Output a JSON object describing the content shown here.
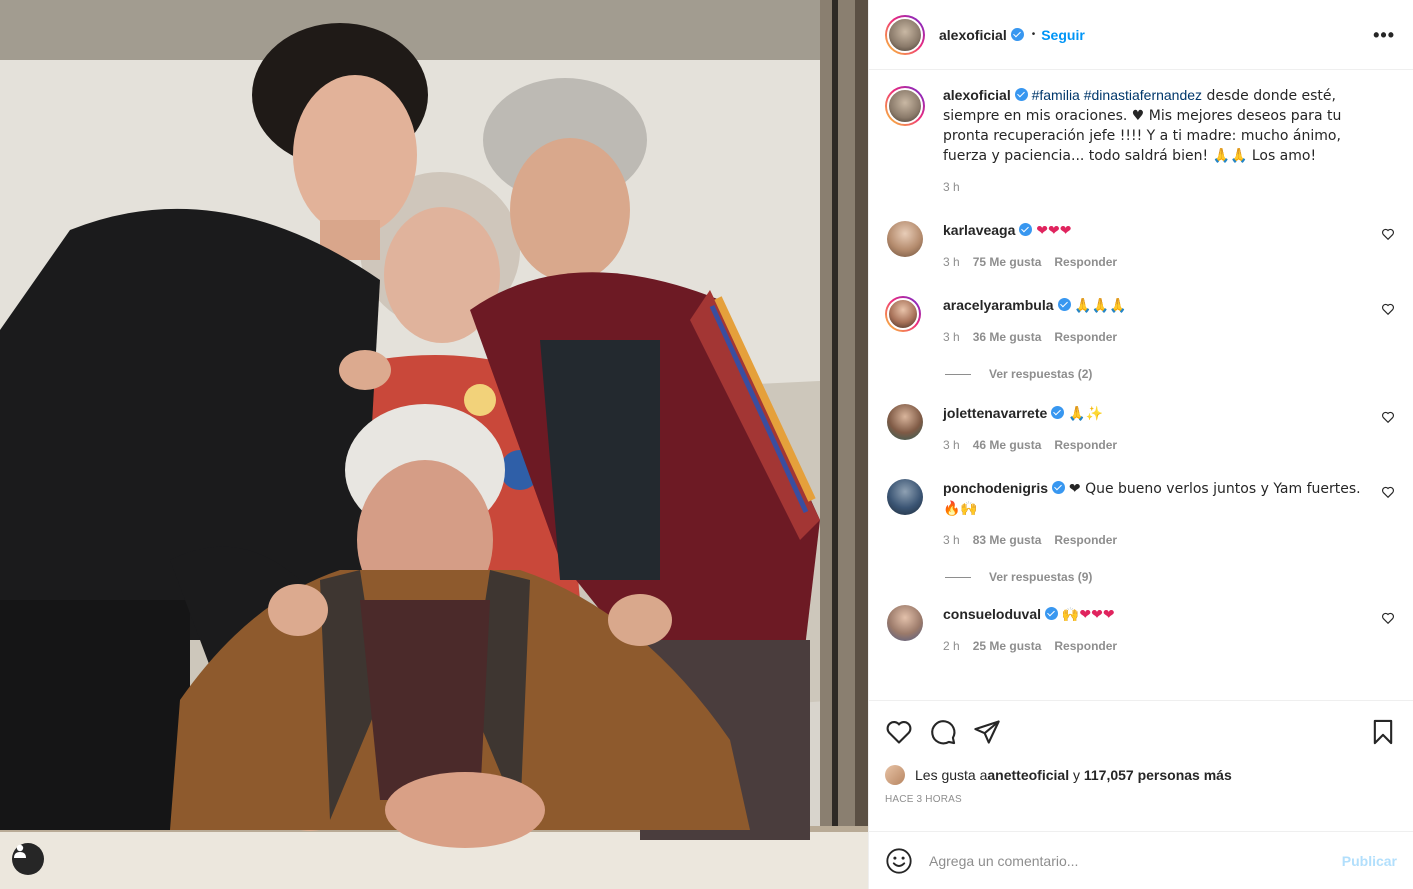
{
  "post": {
    "username": "alexoficial",
    "follow_label": "Seguir",
    "separator": "•",
    "more_label": "•••",
    "caption": {
      "username": "alexoficial",
      "hashtag1": "#familia",
      "hashtag2": "#dinastiafernandez",
      "text": " desde donde esté, siempre en mis oraciones. ♥ Mis mejores deseos para tu pronta recuperación jefe !!!! Y a ti madre: mucho ánimo, fuerza y paciencia... todo saldrá bien! 🙏🙏 Los amo!",
      "time": "3 h"
    }
  },
  "comments": [
    {
      "username": "karlaveaga",
      "text": "❤❤❤",
      "time": "3 h",
      "likes": "75 Me gusta",
      "reply": "Responder",
      "replies": ""
    },
    {
      "username": "aracelyarambula",
      "text": "🙏🙏🙏",
      "time": "3 h",
      "likes": "36 Me gusta",
      "reply": "Responder",
      "replies": "Ver respuestas (2)"
    },
    {
      "username": "jolettenavarrete",
      "text": "🙏✨",
      "time": "3 h",
      "likes": "46 Me gusta",
      "reply": "Responder",
      "replies": ""
    },
    {
      "username": "ponchodenigris",
      "text": "❤ Que bueno verlos juntos y Yam fuertes. 🔥🙌",
      "time": "3 h",
      "likes": "83 Me gusta",
      "reply": "Responder",
      "replies": "Ver respuestas (9)"
    },
    {
      "username": "consueloduval",
      "text": "🙌❤❤❤",
      "time": "2 h",
      "likes": "25 Me gusta",
      "reply": "Responder",
      "replies": ""
    }
  ],
  "likes": {
    "prefix": "Les gusta a ",
    "user": "anetteoficial",
    "middle": " y ",
    "count": "117,057 personas más"
  },
  "time_ago": "HACE 3 HORAS",
  "composer": {
    "placeholder": "Agrega un comentario...",
    "publish": "Publicar"
  },
  "colors": {
    "accent": "#0095f6",
    "verified": "#3897f0",
    "muted": "#8e8e8e",
    "heart_red": "#e0245e"
  },
  "icons": [
    "heart-icon",
    "comment-icon",
    "share-icon",
    "bookmark-icon",
    "emoji-icon",
    "user-tag-icon",
    "verified-badge-icon"
  ]
}
